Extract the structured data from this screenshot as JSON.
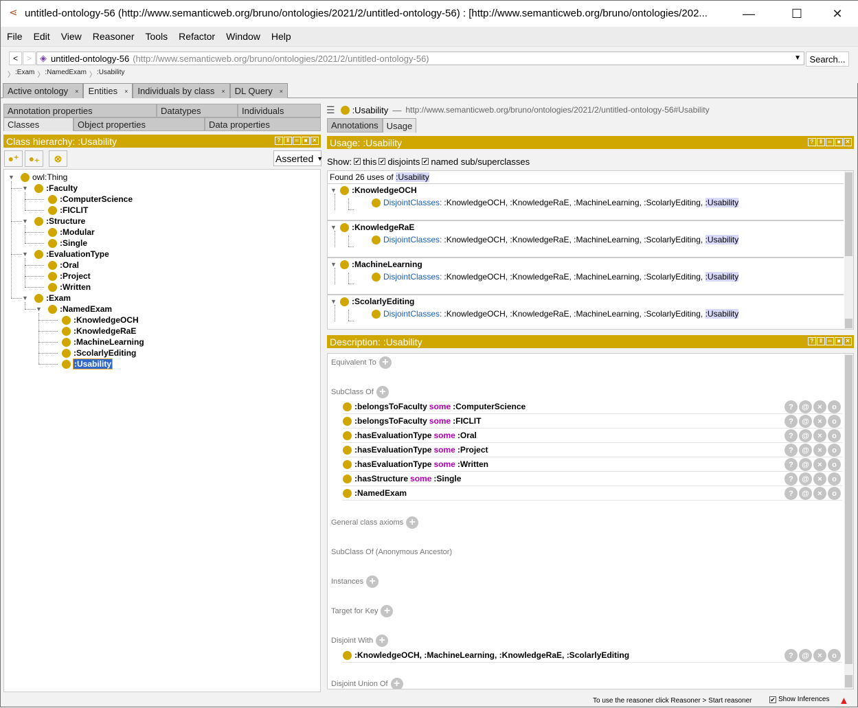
{
  "window": {
    "title": "untitled-ontology-56 (http://www.semanticweb.org/bruno/ontologies/2021/2/untitled-ontology-56)  : [http://www.semanticweb.org/bruno/ontologies/202...",
    "minimize": "—",
    "maximize": "☐",
    "close": "✕"
  },
  "menu": [
    "File",
    "Edit",
    "View",
    "Reasoner",
    "Tools",
    "Refactor",
    "Window",
    "Help"
  ],
  "nav": {
    "back": "<",
    "forward": ">",
    "ontology_name": "untitled-ontology-56",
    "ontology_iri": "(http://www.semanticweb.org/bruno/ontologies/2021/2/untitled-ontology-56)",
    "search_label": "Search...",
    "breadcrumb": [
      ":Exam",
      ":NamedExam",
      ":Usability"
    ]
  },
  "main_tabs": [
    {
      "label": "Active ontology",
      "close": "×"
    },
    {
      "label": "Entities",
      "close": "×",
      "active": true
    },
    {
      "label": "Individuals by class",
      "close": "×"
    },
    {
      "label": "DL Query",
      "close": "×"
    }
  ],
  "left": {
    "tabs_row1": [
      "Annotation properties",
      "Datatypes",
      "Individuals"
    ],
    "tabs_row2": [
      "Classes",
      "Object properties",
      "Data properties"
    ],
    "hierarchy_title": "Class hierarchy: :Usability",
    "view_icons": [
      "?",
      "▮▮",
      "☰",
      "□",
      "✕"
    ],
    "mode": "Asserted",
    "tree": [
      {
        "label": "owl:Thing",
        "level": 0,
        "expanded": true
      },
      {
        "label": ":Faculty",
        "level": 1,
        "expanded": true
      },
      {
        "label": ":ComputerScience",
        "level": 2
      },
      {
        "label": ":FICLIT",
        "level": 2
      },
      {
        "label": ":Structure",
        "level": 1,
        "expanded": true
      },
      {
        "label": ":Modular",
        "level": 2
      },
      {
        "label": ":Single",
        "level": 2
      },
      {
        "label": ":EvaluationType",
        "level": 1,
        "expanded": true
      },
      {
        "label": ":Oral",
        "level": 2
      },
      {
        "label": ":Project",
        "level": 2
      },
      {
        "label": ":Written",
        "level": 2
      },
      {
        "label": ":Exam",
        "level": 1,
        "expanded": true
      },
      {
        "label": ":NamedExam",
        "level": 2,
        "expanded": true
      },
      {
        "label": ":KnowledgeOCH",
        "level": 3
      },
      {
        "label": ":KnowledgeRaE",
        "level": 3
      },
      {
        "label": ":MachineLearning",
        "level": 3
      },
      {
        "label": ":ScolarlyEditing",
        "level": 3
      },
      {
        "label": ":Usability",
        "level": 3,
        "selected": true
      }
    ]
  },
  "right": {
    "entity_name": ":Usability",
    "entity_dash": "—",
    "entity_iri": "http://www.semanticweb.org/bruno/ontologies/2021/2/untitled-ontology-56#Usability",
    "tabs": [
      "Annotations",
      "Usage"
    ],
    "usage": {
      "title": "Usage: :Usability",
      "show_label": "Show:",
      "show_options": [
        {
          "label": "this",
          "checked": true
        },
        {
          "label": "disjoints",
          "checked": true
        },
        {
          "label": "named sub/superclasses",
          "checked": true
        }
      ],
      "found_prefix": "Found 26 uses of",
      "found_entity": ":Usability",
      "groups": [
        {
          "head": ":KnowledgeOCH",
          "keyword": "DisjointClasses:",
          "axiom": ":KnowledgeOCH, :KnowledgeRaE, :MachineLearning, :ScolarlyEditing,",
          "highlight": ":Usability"
        },
        {
          "head": ":KnowledgeRaE",
          "keyword": "DisjointClasses:",
          "axiom": ":KnowledgeOCH, :KnowledgeRaE, :MachineLearning, :ScolarlyEditing,",
          "highlight": ":Usability"
        },
        {
          "head": ":MachineLearning",
          "keyword": "DisjointClasses:",
          "axiom": ":KnowledgeOCH, :KnowledgeRaE, :MachineLearning, :ScolarlyEditing,",
          "highlight": ":Usability"
        },
        {
          "head": ":ScolarlyEditing",
          "keyword": "DisjointClasses:",
          "axiom": ":KnowledgeOCH, :KnowledgeRaE, :MachineLearning, :ScolarlyEditing,",
          "highlight": ":Usability"
        }
      ]
    },
    "description": {
      "title": "Description: :Usability",
      "sections": {
        "equivalent_to": "Equivalent To",
        "subclass_of": "SubClass Of",
        "general_axioms": "General class axioms",
        "anon_ancestor": "SubClass Of (Anonymous Ancestor)",
        "instances": "Instances",
        "target_for_key": "Target for Key",
        "disjoint_with": "Disjoint With",
        "disjoint_union_of": "Disjoint Union Of"
      },
      "subclass_of": [
        {
          "prop": ":belongsToFaculty",
          "kw": "some",
          "filler": ":ComputerScience"
        },
        {
          "prop": ":belongsToFaculty",
          "kw": "some",
          "filler": ":FICLIT"
        },
        {
          "prop": ":hasEvaluationType",
          "kw": "some",
          "filler": ":Oral"
        },
        {
          "prop": ":hasEvaluationType",
          "kw": "some",
          "filler": ":Project"
        },
        {
          "prop": ":hasEvaluationType",
          "kw": "some",
          "filler": ":Written"
        },
        {
          "prop": ":hasStructure",
          "kw": "some",
          "filler": ":Single"
        },
        {
          "prop": ":NamedExam",
          "kw": "",
          "filler": ""
        }
      ],
      "disjoint_with": ":KnowledgeOCH, :MachineLearning, :KnowledgeRaE, :ScolarlyEditing",
      "frame_actions": [
        "?",
        "@",
        "×",
        "o"
      ]
    }
  },
  "status": {
    "message": "To use the reasoner click Reasoner > Start reasoner",
    "show_inferences": "Show Inferences",
    "show_inferences_checked": true,
    "warning_icon": "▲"
  },
  "colors": {
    "accent_gold": "#d0a700",
    "keyword_blue": "#1a5fb4",
    "some_magenta": "#b000b0",
    "selection_blue": "#2f68c8",
    "highlight": "#d8d8f8"
  }
}
